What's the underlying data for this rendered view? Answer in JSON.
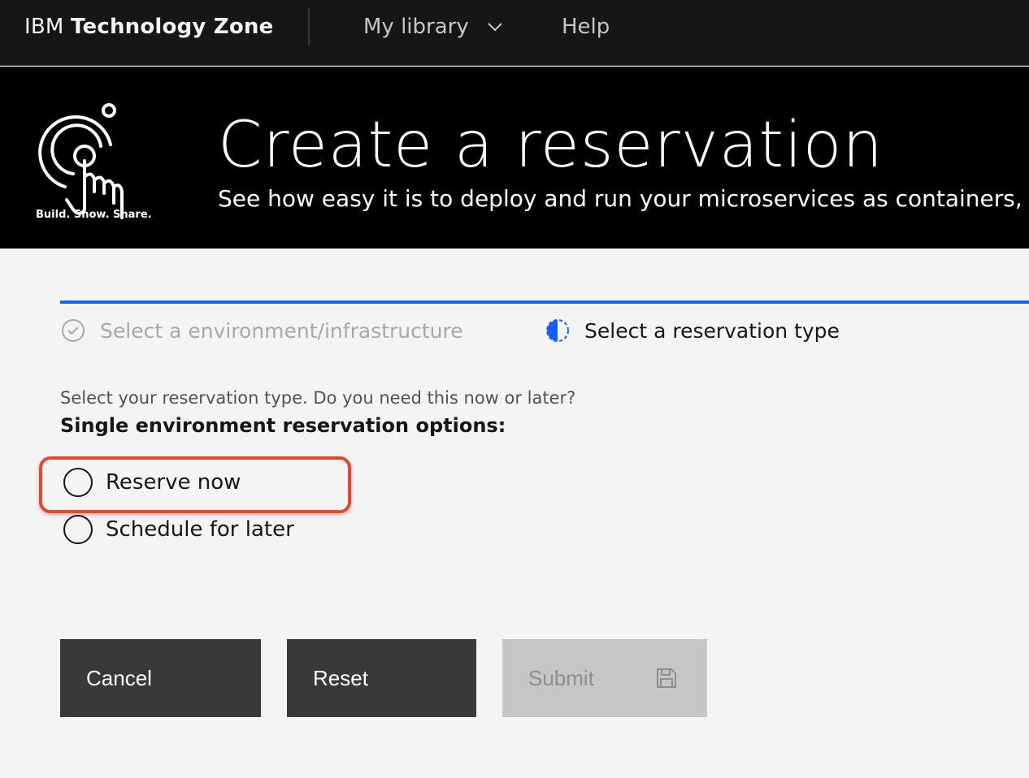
{
  "nav": {
    "brand_prefix": "IBM",
    "brand_name": "Technology Zone",
    "menu_library": "My library",
    "menu_help": "Help"
  },
  "banner": {
    "logo_caption": "Build. Show. Share.",
    "title": "Create a reservation",
    "subtitle": "See how easy it is to deploy and run your microservices as containers,"
  },
  "progress": {
    "steps": [
      {
        "label": "Select a environment/infrastructure",
        "state": "complete"
      },
      {
        "label": "Select a reservation type",
        "state": "current"
      }
    ]
  },
  "form": {
    "question": "Select your reservation type. Do you need this now or later?",
    "heading": "Single environment reservation options:",
    "options": [
      {
        "label": "Reserve now",
        "selected": false,
        "highlighted": true
      },
      {
        "label": "Schedule for later",
        "selected": false
      }
    ]
  },
  "buttons": {
    "cancel": "Cancel",
    "reset": "Reset",
    "submit": "Submit",
    "submit_disabled": true
  },
  "colors": {
    "progress_accent": "#0f62fe",
    "highlight": "#e5472d",
    "nav_bg": "#161616",
    "banner_bg": "#000000"
  },
  "icons": {
    "library_menu": "chevron-down-icon",
    "step_complete": "checkmark-outline-icon",
    "step_current": "incomplete-circle-icon",
    "submit": "save-icon"
  }
}
